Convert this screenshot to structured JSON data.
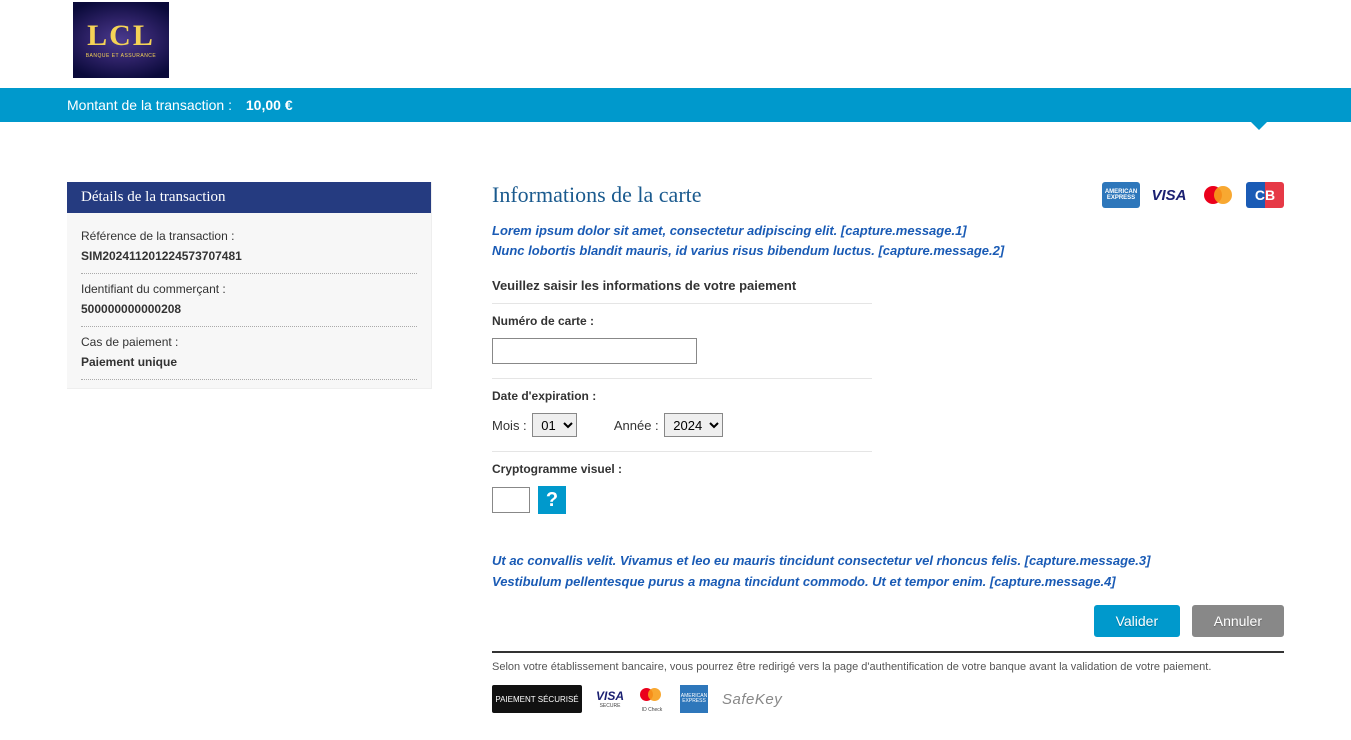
{
  "logo": {
    "text": "LCL",
    "subtitle": "BANQUE ET ASSURANCE"
  },
  "amount_bar": {
    "label": "Montant de la transaction  :",
    "value": "10,00 €"
  },
  "details": {
    "title": "Détails de la transaction",
    "ref_label": "Référence de la transaction :",
    "ref_value": "SIM20241120122457370748​1",
    "merchant_label": "Identifiant du commerçant :",
    "merchant_value": "500000000000208",
    "case_label": "Cas de paiement :",
    "case_value": "Paiement unique"
  },
  "card": {
    "title": "Informations de la carte",
    "msg1": "Lorem ipsum dolor sit amet, consectetur adipiscing elit. [capture.message.1]",
    "msg2": "Nunc lobortis blandit mauris, id varius risus bibendum luctus. [capture.message.2]",
    "instruction": "Veuillez saisir les informations de votre paiement",
    "card_number_label": "Numéro de carte :",
    "exp_label": "Date d'expiration :",
    "month_label": "Mois :",
    "year_label": "Année :",
    "month_selected": "01",
    "year_selected": "2024",
    "cvv_label": "Cryptogramme visuel :",
    "help": "?",
    "msg3": "Ut ac convallis velit. Vivamus et leo eu mauris tincidunt consectetur vel rhoncus felis. [capture.message.3]",
    "msg4": "Vestibulum pellentesque purus a magna tincidunt commodo. Ut et tempor enim. [capture.message.4]",
    "submit": "Valider",
    "cancel": "Annuler",
    "footer_note": "Selon votre établissement bancaire, vous pourrez être redirigé vers la page d'authentification de votre banque avant la validation de votre paiement."
  },
  "card_brands": {
    "amex": "AMERICAN EXPRESS",
    "visa": "VISA",
    "cb": "CB"
  },
  "security": {
    "badge": "PAIEMENT SÉCURISÉ",
    "visa_secure": "SECURE",
    "mc_idcheck": "ID Check",
    "safekey": "SafeKey"
  }
}
